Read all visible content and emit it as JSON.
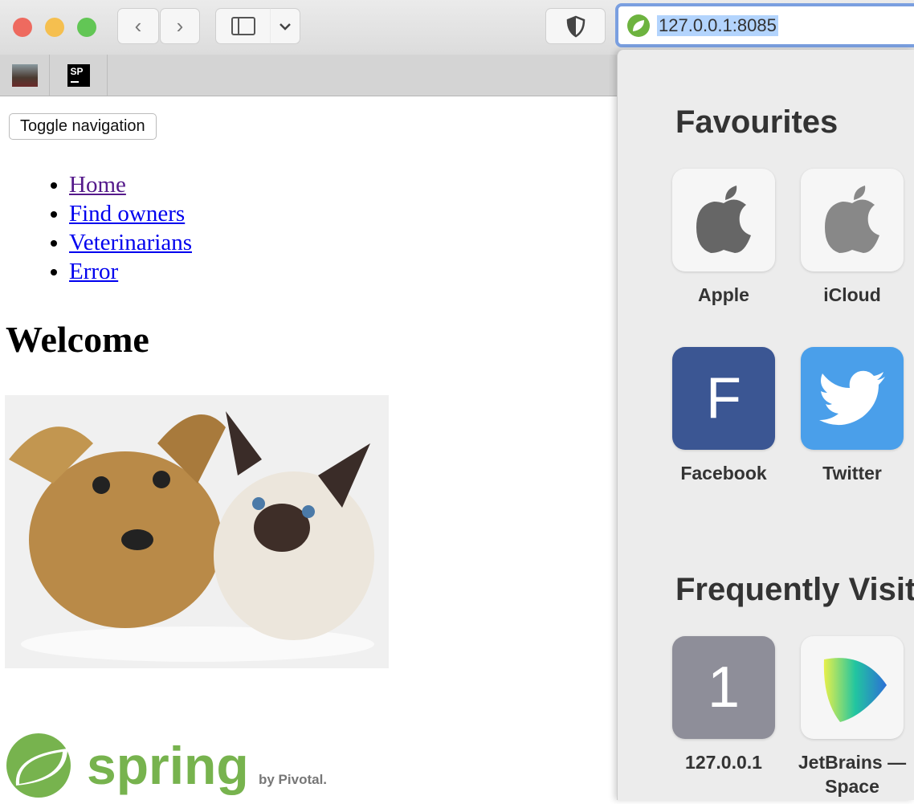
{
  "browser": {
    "url": "127.0.0.1:8085",
    "tabs": [
      {
        "icon": "photo-favicon"
      },
      {
        "icon": "sp-favicon",
        "text": "SP"
      }
    ]
  },
  "page": {
    "toggle_label": "Toggle navigation",
    "nav": [
      "Home",
      "Find owners",
      "Veterinarians",
      "Error"
    ],
    "heading": "Welcome",
    "logo_text": "spring",
    "logo_by": "by Pivotal."
  },
  "panel": {
    "favourites_title": "Favourites",
    "favourites": [
      {
        "label": "Apple",
        "icon": "apple-icon"
      },
      {
        "label": "iCloud",
        "icon": "apple-icon"
      },
      {
        "label": "Facebook",
        "glyph": "F",
        "color": "#3b5693"
      },
      {
        "label": "Twitter",
        "icon": "twitter-bird-icon",
        "color": "#4a9fea"
      }
    ],
    "frequent_title": "Frequently Visited",
    "frequent": [
      {
        "label": "127.0.0.1",
        "glyph": "1",
        "color": "#8e8e99"
      },
      {
        "label": "JetBrains — Space",
        "icon": "jetbrains-space-icon"
      }
    ]
  }
}
